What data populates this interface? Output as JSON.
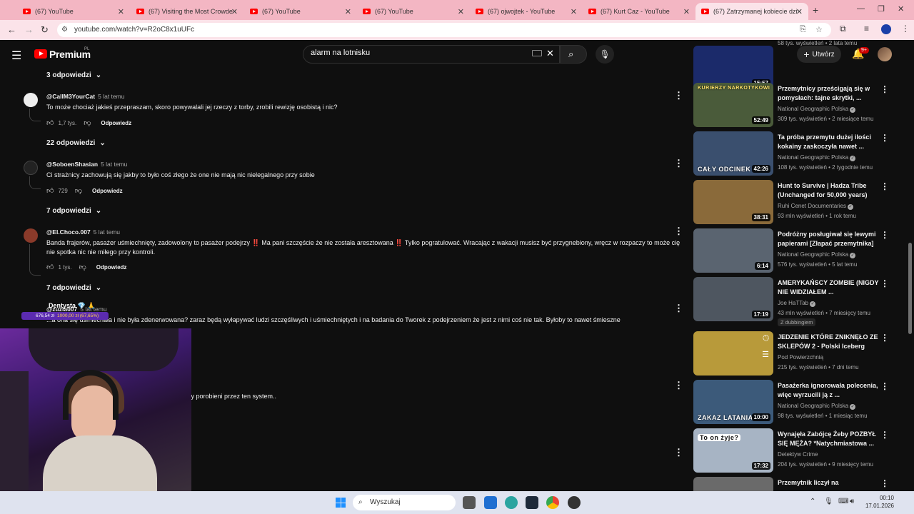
{
  "browser": {
    "tabs": [
      {
        "label": "(67) YouTube",
        "active": false
      },
      {
        "label": "(67) Visiting the Most Crowded",
        "active": false
      },
      {
        "label": "(67) YouTube",
        "active": false
      },
      {
        "label": "(67) YouTube",
        "active": false
      },
      {
        "label": "(67) ojwojtek - YouTube",
        "active": false
      },
      {
        "label": "(67) Kurt Caz - YouTube",
        "active": false
      },
      {
        "label": "(67) Zatrzymanej kobiecie dziw",
        "active": true
      }
    ],
    "new_tab": "+",
    "url": "youtube.com/watch?v=R2oC8x1uUFc"
  },
  "youtube": {
    "logo_text": "Premium",
    "region": "PL",
    "search_value": "alarm na lotnisku",
    "create_label": "Utwórz",
    "notif_badge": "9+"
  },
  "comments": [
    {
      "type": "replies",
      "label": "3 odpowiedzi"
    },
    {
      "type": "comment",
      "author": "@CallM3YourCat",
      "time": "5 lat temu",
      "text": "To może chociaż jakieś przepraszam, skoro powywalali jej rzeczy z torby, zrobili rewizję osobistą i nic?",
      "likes": "1,7 tys.",
      "reply_label": "Odpowiedz"
    },
    {
      "type": "replies",
      "label": "22 odpowiedzi"
    },
    {
      "type": "comment",
      "author": "@SoboenShasian",
      "time": "5 lat temu",
      "text": "Ci strażnicy zachowują się jakby to było coś złego że one nie mają nic nielegalnego przy sobie",
      "likes": "729",
      "reply_label": "Odpowiedz"
    },
    {
      "type": "replies",
      "label": "7 odpowiedzi"
    },
    {
      "type": "comment",
      "author": "@El.Choco.007",
      "time": "5 lat temu",
      "text_a": "Banda frajerów, pasażer uśmiechnięty, zadowolony to pasażer podejrzy ",
      "text_b": " Ma pani szczęście że nie została aresztowana ",
      "text_c": " Tylko pogratulować. Wracając z wakacji musisz być przygnebiony, wręcz w rozpaczy to może cię nie spotka nic nie miłego przy kontroli.",
      "excl": "‼️",
      "likes": "1 tys.",
      "reply_label": "Odpowiedz"
    },
    {
      "type": "replies",
      "label": "7 odpowiedzi"
    },
    {
      "type": "comment_partial",
      "author": "@zuzia007",
      "time": "5 lat temu",
      "text": "...a ona się uśmiechała i nie była zdenerwowana? zaraz będą wyłapywać ludzi szczęśliwych i uśmiechniętych i na badania do Tworek z podejrzeniem że jest z nimi coś nie tak. Byłoby to nawet śmieszne"
    },
    {
      "type": "text_partial",
      "text": "...y porobieni przez ten system.."
    }
  ],
  "donation": {
    "name": "Dentysta 💎 🙏",
    "bar": "676,54 zł",
    "goal": "1000,00 zł (67,65%)"
  },
  "sidebar": [
    {
      "title": "",
      "channel": "",
      "meta": "58 tys. wyświetleń • 2 lata temu",
      "duration": "15:57",
      "thumb": "#1b2a6a",
      "partial": true
    },
    {
      "title": "Przemytnicy prześcigają się w pomysłach: tajne skrytki, ...",
      "channel": "National Geographic Polska",
      "meta": "309 tys. wyświetleń • 2 miesiące temu",
      "duration": "52:49",
      "thumb": "#4a5b3a",
      "thumb_text": "KURIERZY NARKOTYKOWI"
    },
    {
      "title": "Ta próba przemytu dużej ilości kokainy zaskoczyła nawet ...",
      "channel": "National Geographic Polska",
      "meta": "108 tys. wyświetleń • 2 tygodnie temu",
      "duration": "42:26",
      "thumb": "#3a4f6e",
      "thumb_text": "CAŁY ODCINEK"
    },
    {
      "title": "Hunt to Survive | Hadza Tribe (Unchanged for 50,000 years)",
      "channel": "Ruhi Cenet Documentaries",
      "meta": "93 mln wyświetleń • 1 rok temu",
      "duration": "38:31",
      "thumb": "#8a6a3a"
    },
    {
      "title": "Podróżny posługiwał się lewymi papierami [Złapać przemytnika]",
      "channel": "National Geographic Polska",
      "meta": "576 tys. wyświetleń • 5 lat temu",
      "duration": "6:14",
      "thumb": "#5a6470"
    },
    {
      "title": "AMERYKAŃSCY ZOMBIE (NIGDY NIE WIDZIAŁEM ...",
      "channel": "Joe HaTTab",
      "meta": "43 mln wyświetleń • 7 miesięcy temu",
      "duration": "17:19",
      "thumb": "#4e5660",
      "dub": "Z dubbingiem"
    },
    {
      "title": "JEDZENIE KTÓRE ZNIKNĘŁO ZE SKLEPÓW 2 - Polski Iceberg",
      "channel": "Pod Powierzchnią",
      "meta": "215 tys. wyświetleń • 7 dni temu",
      "duration": "",
      "thumb": "#b89a3a"
    },
    {
      "title": "Pasażerka ignorowała polecenia, więc wyrzucili ją z ...",
      "channel": "National Geographic Polska",
      "meta": "98 tys. wyświetleń • 1 miesiąc temu",
      "duration": "10:00",
      "thumb": "#3c5a7a",
      "thumb_text": "ZAKAZ LATANIA"
    },
    {
      "title": "Wynajęła Zabójcę Żeby POZBYŁ SIĘ MĘŻA? *Natychmiastowa ...",
      "channel": "Detektyw Crime",
      "meta": "204 tys. wyświetleń • 9 miesięcy temu",
      "duration": "17:32",
      "thumb": "#a7b4c4",
      "thumb_text": "To on żyje?"
    },
    {
      "title": "Przemytnik liczył na",
      "channel": "",
      "meta": "",
      "duration": "",
      "thumb": "#6a6a6a",
      "partial": true
    }
  ],
  "taskbar": {
    "search_label": "Wyszukaj",
    "time": "00:10",
    "date": "17.01.2026"
  }
}
